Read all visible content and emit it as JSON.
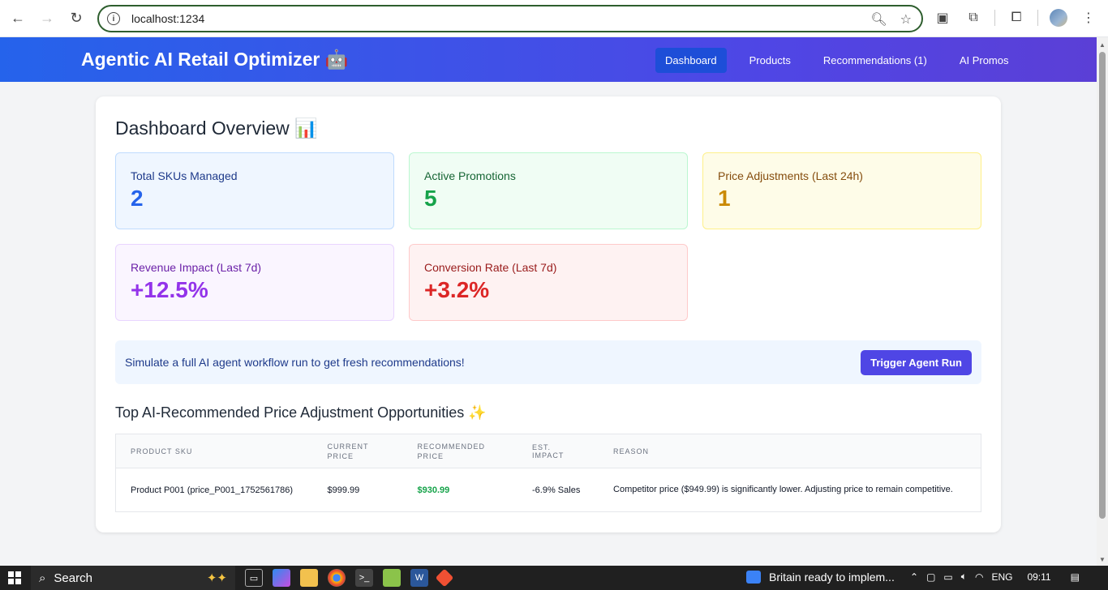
{
  "browser": {
    "url": "localhost:1234"
  },
  "app": {
    "title": "Agentic AI Retail Optimizer 🤖",
    "nav": [
      {
        "label": "Dashboard",
        "active": true
      },
      {
        "label": "Products",
        "active": false
      },
      {
        "label": "Recommendations (1)",
        "active": false
      },
      {
        "label": "AI Promos",
        "active": false
      }
    ]
  },
  "dashboard": {
    "title": "Dashboard Overview 📊",
    "stats": [
      {
        "label": "Total SKUs Managed",
        "value": "2"
      },
      {
        "label": "Active Promotions",
        "value": "5"
      },
      {
        "label": "Price Adjustments (Last 24h)",
        "value": "1"
      },
      {
        "label": "Revenue Impact (Last 7d)",
        "value": "+12.5%"
      },
      {
        "label": "Conversion Rate (Last 7d)",
        "value": "+3.2%"
      }
    ],
    "agent_message": "Simulate a full AI agent workflow run to get fresh recommendations!",
    "agent_button": "Trigger Agent Run",
    "section_title": "Top AI-Recommended Price Adjustment Opportunities ✨",
    "table": {
      "headers": [
        "PRODUCT SKU",
        "CURRENT PRICE",
        "RECOMMENDED PRICE",
        "EST. IMPACT",
        "REASON"
      ],
      "rows": [
        {
          "sku": "Product P001 (price_P001_1752561786)",
          "current": "$999.99",
          "recommended": "$930.99",
          "impact": "-6.9% Sales",
          "reason": "Competitor price ($949.99) is significantly lower. Adjusting price to remain competitive."
        }
      ]
    }
  },
  "taskbar": {
    "search_placeholder": "Search",
    "news": "Britain ready to implem...",
    "language": "ENG",
    "time": "09:11"
  }
}
